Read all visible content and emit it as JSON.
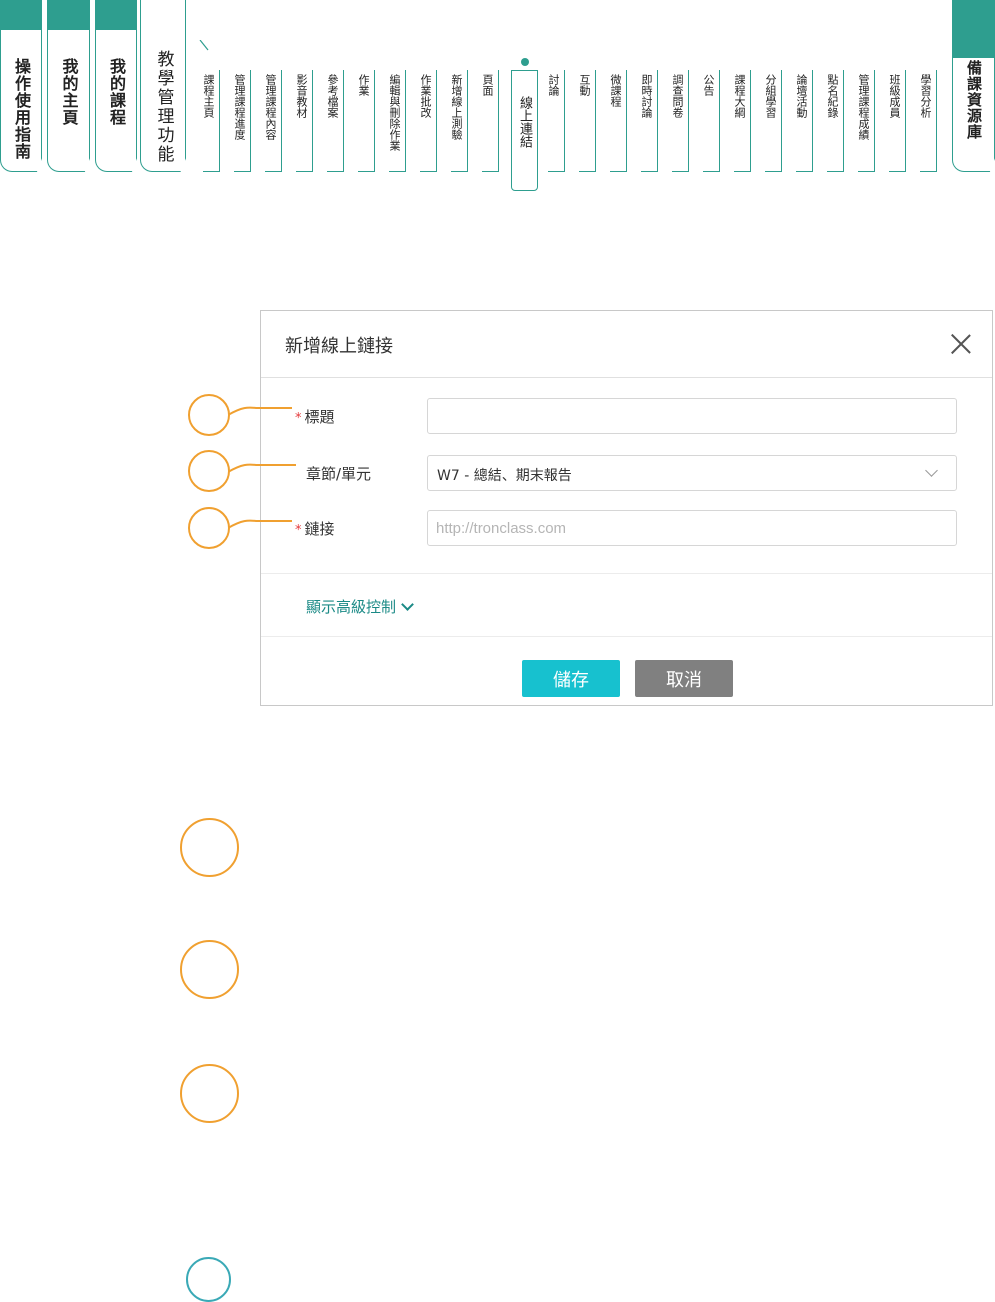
{
  "nav": {
    "main_tabs": [
      "操作使用指南",
      "我的主頁",
      "我的課程"
    ],
    "section_tab": "教學管理功能",
    "sub_tabs": [
      "課程主頁",
      "管理課程進度",
      "管理課程內容",
      "影音教材",
      "參考檔案",
      "作業",
      "編輯與刪除作業",
      "作業批改",
      "新增線上測驗",
      "頁面",
      "線上連結",
      "討論",
      "互動",
      "微課程",
      "即時討論",
      "調查問卷",
      "公告",
      "課程大綱",
      "分組學習",
      "論壇活動",
      "點名紀錄",
      "管理課程成績",
      "班級成員",
      "學習分析"
    ],
    "active_sub_tab": "線上連結",
    "resource_tab": "備課資源庫"
  },
  "dialog": {
    "title": "新增線上鏈接",
    "fields": {
      "title_label": "標題",
      "chapter_label": "章節/單元",
      "chapter_value": "W7 - 總結、期末報告",
      "link_label": "鏈接",
      "link_placeholder": "http://tronclass.com"
    },
    "required_mark": "*",
    "advanced_label": "顯示高級控制",
    "save_label": "儲存",
    "cancel_label": "取消"
  },
  "colors": {
    "accent": "#2e9e8f",
    "callout": "#f0a030",
    "save": "#17c1cf",
    "cancel": "#808080",
    "link": "#1b8a86",
    "required": "#e4393c"
  }
}
